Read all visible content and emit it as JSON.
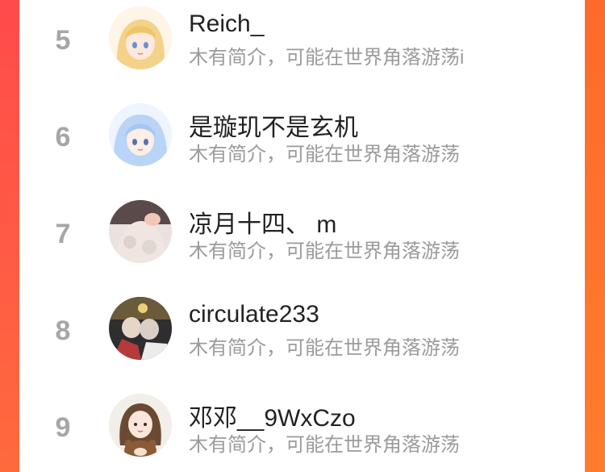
{
  "leaderboard": {
    "entries": [
      {
        "rank": "5",
        "name": "Reich_",
        "bio": "木有简介，可能在世界角落游荡i",
        "avatar_icon": "anime-girl-blonde-avatar-icon"
      },
      {
        "rank": "6",
        "name": "是璇玑不是玄机",
        "bio": "木有简介，可能在世界角落游荡",
        "avatar_icon": "anime-girl-blue-hair-avatar-icon"
      },
      {
        "rank": "7",
        "name": "凉月十四、 m",
        "bio": "木有简介，可能在世界角落游荡",
        "avatar_icon": "photo-person-fur-coat-avatar-icon"
      },
      {
        "rank": "8",
        "name": "circulate233",
        "bio": "木有简介，可能在世界角落游荡",
        "avatar_icon": "anime-two-characters-avatar-icon"
      },
      {
        "rank": "9",
        "name": "邓邓__9WxCzo",
        "bio": "木有简介，可能在世界角落游荡",
        "avatar_icon": "illustrated-girl-brown-bear-avatar-icon"
      }
    ]
  },
  "colors": {
    "page_bg_left": "#ff4b4b",
    "page_bg_right": "#ff7a2e",
    "rank_color": "#a6a6a6",
    "name_color": "#222222",
    "bio_color": "#9b9b9b"
  }
}
